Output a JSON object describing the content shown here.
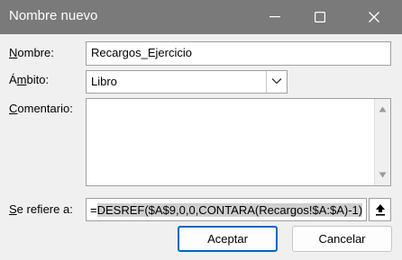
{
  "window": {
    "title": "Nombre nuevo"
  },
  "form": {
    "name_label_key": "N",
    "name_label_rest": "ombre:",
    "name_value": "Recargos_Ejercicio",
    "scope_label_pre": "Á",
    "scope_label_key": "m",
    "scope_label_rest": "bito:",
    "scope_value": "Libro",
    "comment_label_key": "C",
    "comment_label_rest": "omentario:",
    "comment_value": "",
    "refers_label_key": "S",
    "refers_label_rest": "e refiere a:",
    "refers_prefix": "=",
    "refers_selected": "DESREF($A$9,0,0,CONTARA(Recargos!$A:$A)-1)"
  },
  "buttons": {
    "ok": "Aceptar",
    "cancel": "Cancelar"
  },
  "icons": {
    "minimize": "minimize-icon",
    "maximize": "maximize-icon",
    "close": "close-icon",
    "dropdown": "chevron-down-icon",
    "scroll_up": "triangle-up-icon",
    "scroll_down": "triangle-down-icon",
    "collapse": "upload-arrow-icon"
  },
  "colors": {
    "titlebar": "#7a7a7a",
    "accent": "#0067c0",
    "selection": "#cfcfcf"
  }
}
